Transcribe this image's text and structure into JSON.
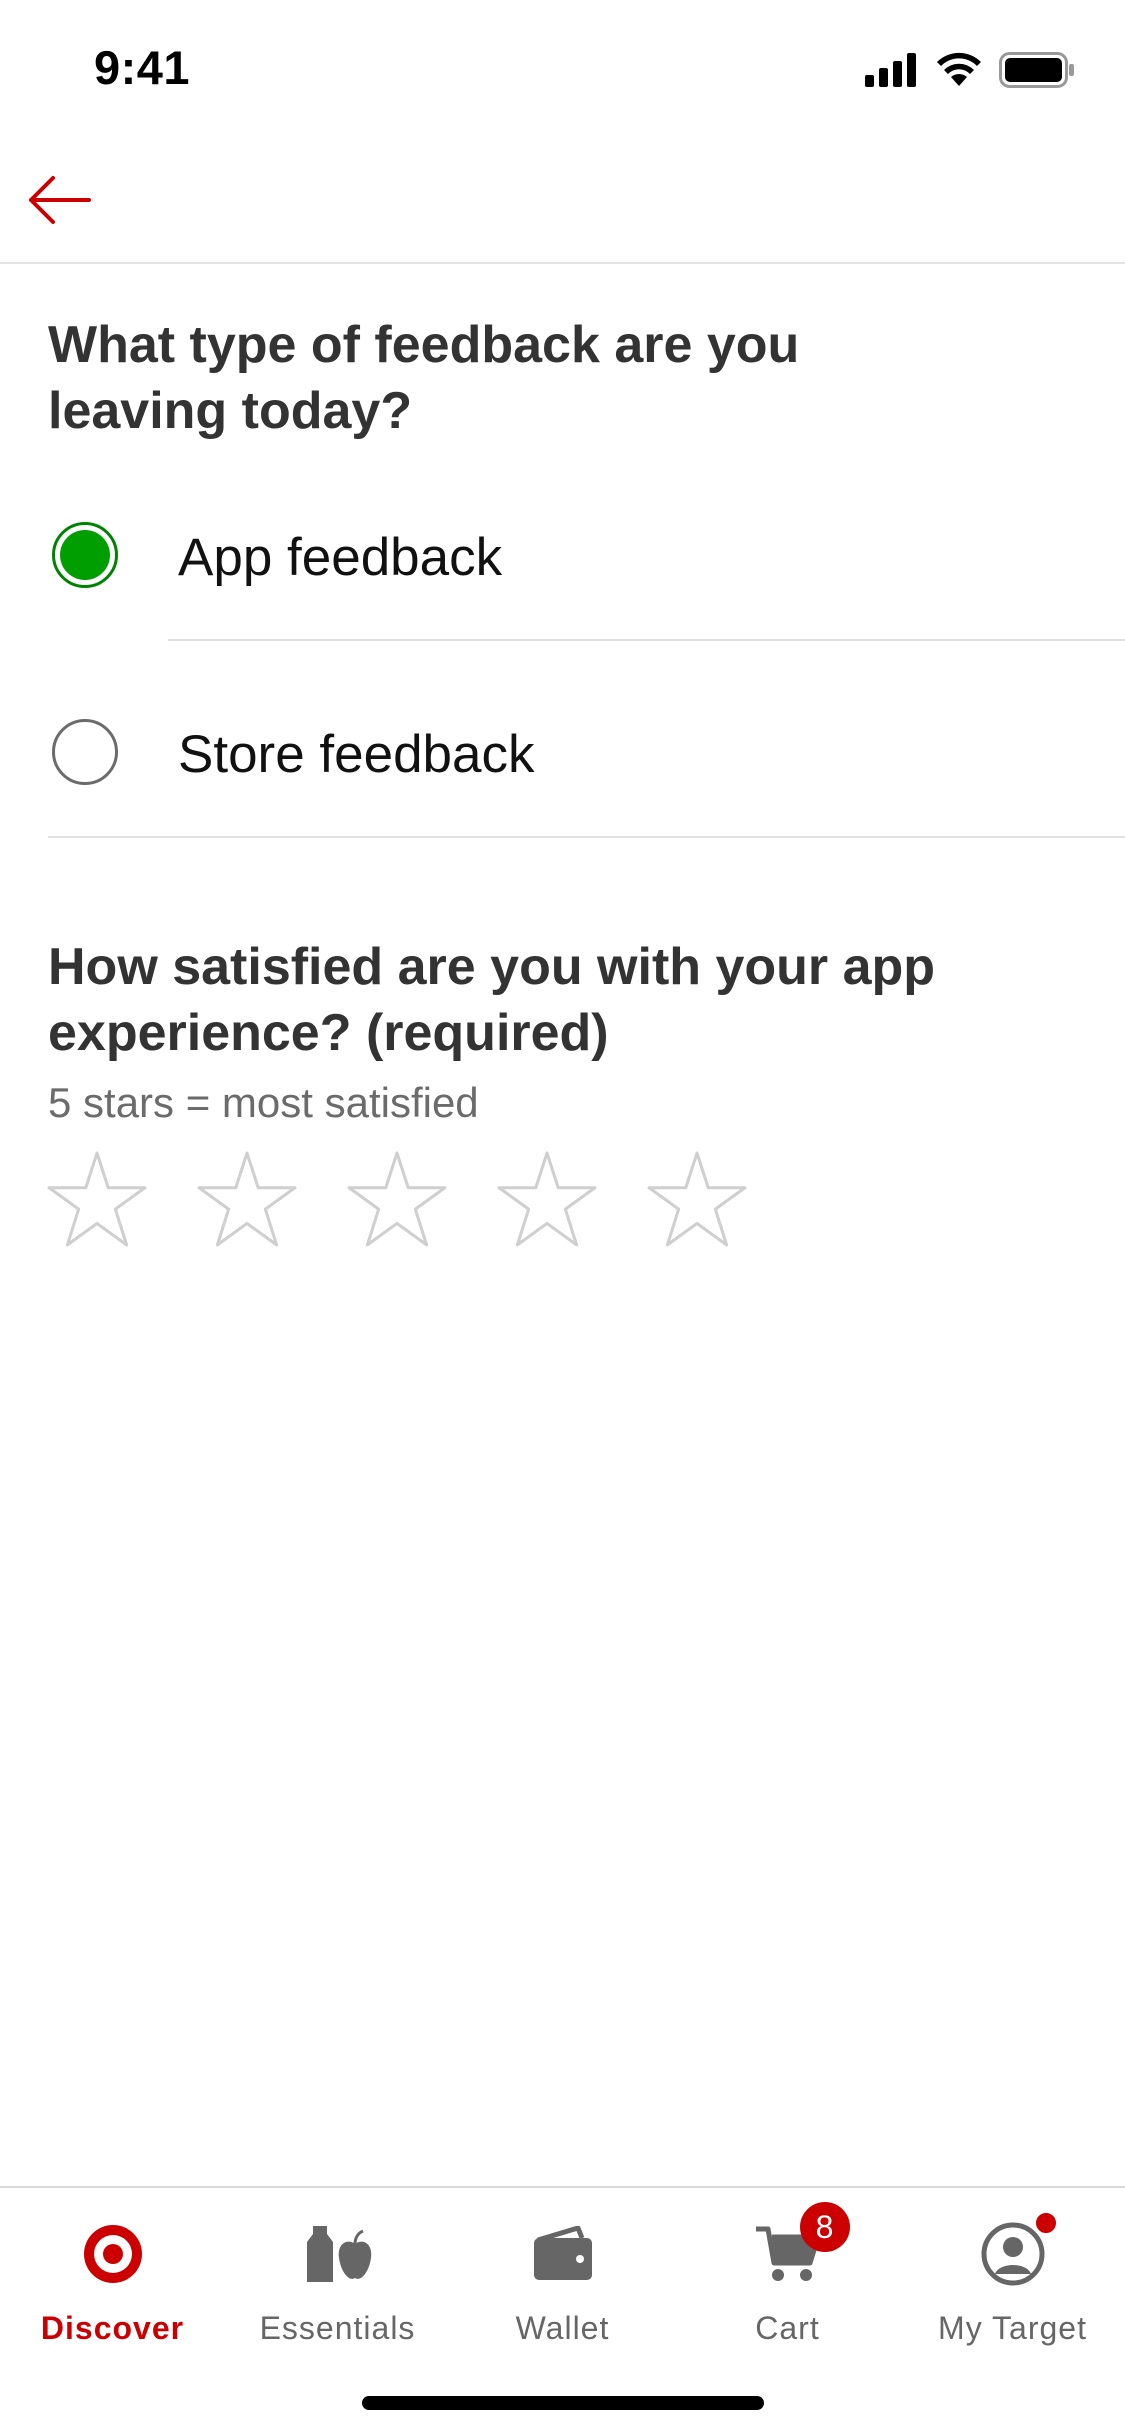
{
  "status_bar": {
    "time": "9:41"
  },
  "question_type": {
    "title": "What type of feedback are you leaving today?",
    "options": [
      {
        "label": "App feedback",
        "selected": true
      },
      {
        "label": "Store feedback",
        "selected": false
      }
    ]
  },
  "question_satisfaction": {
    "title": "How satisfied are you with your app experience? (required)",
    "hint": "5 stars = most satisfied",
    "rating": 0,
    "max_rating": 5
  },
  "bottom_nav": {
    "items": [
      {
        "label": "Discover",
        "icon": "target-logo-icon",
        "active": true
      },
      {
        "label": "Essentials",
        "icon": "essentials-icon",
        "active": false
      },
      {
        "label": "Wallet",
        "icon": "wallet-icon",
        "active": false
      },
      {
        "label": "Cart",
        "icon": "cart-icon",
        "badge": "8",
        "active": false
      },
      {
        "label": "My Target",
        "icon": "account-icon",
        "active": false
      }
    ]
  },
  "colors": {
    "accent": "#cc0000",
    "selected_radio": "#009e00",
    "text": "#333333"
  }
}
